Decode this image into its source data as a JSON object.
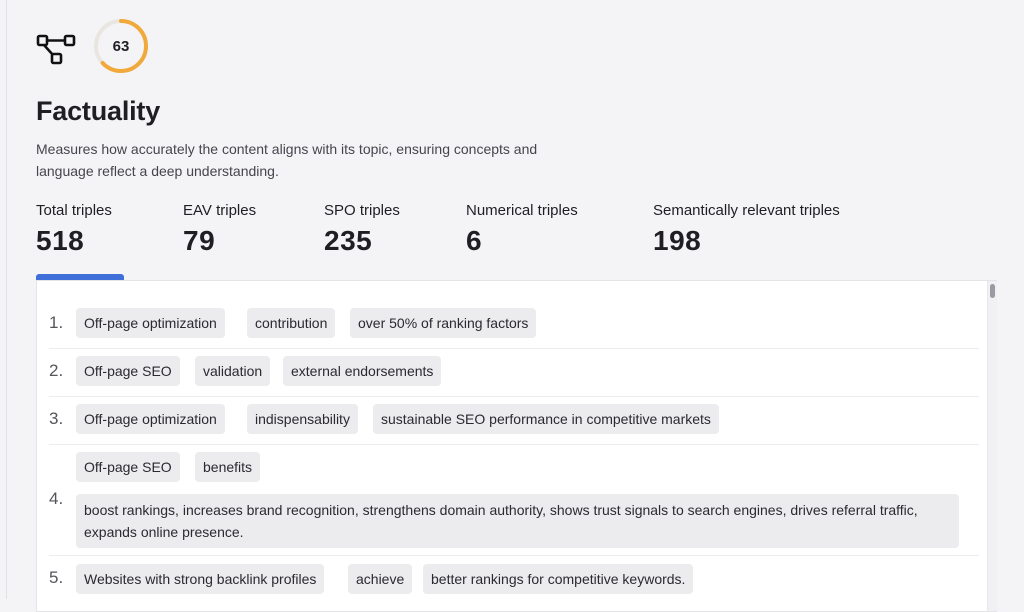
{
  "header": {
    "score": "63",
    "score_fraction": 0.63,
    "icon": "network-nodes-icon",
    "accent_color": "#f0a93a"
  },
  "section": {
    "title": "Factuality",
    "description": "Measures how accurately the content aligns with its topic, ensuring concepts and language reflect a deep understanding."
  },
  "stats": [
    {
      "label": "Total triples",
      "value": "518"
    },
    {
      "label": "EAV triples",
      "value": "79"
    },
    {
      "label": "SPO triples",
      "value": "235"
    },
    {
      "label": "Numerical triples",
      "value": "6"
    },
    {
      "label": "Semantically relevant triples",
      "value": "198"
    }
  ],
  "active_tab_color": "#3f6fd8",
  "triples": [
    {
      "num": "1.",
      "subject": "Off-page optimization",
      "predicate": "contribution",
      "object": "over 50% of ranking factors"
    },
    {
      "num": "2.",
      "subject": "Off-page SEO",
      "predicate": "validation",
      "object": "external endorsements"
    },
    {
      "num": "3.",
      "subject": "Off-page optimization",
      "predicate": "indispensability",
      "object": "sustainable SEO performance in competitive markets"
    },
    {
      "num": "4.",
      "subject": "Off-page SEO",
      "predicate": "benefits",
      "object": "boost rankings, increases brand recognition, strengthens domain authority, shows trust signals to search engines, drives referral traffic, expands online presence."
    },
    {
      "num": "5.",
      "subject": "Websites with strong backlink profiles",
      "predicate": "achieve",
      "object": "better rankings for competitive keywords."
    }
  ]
}
